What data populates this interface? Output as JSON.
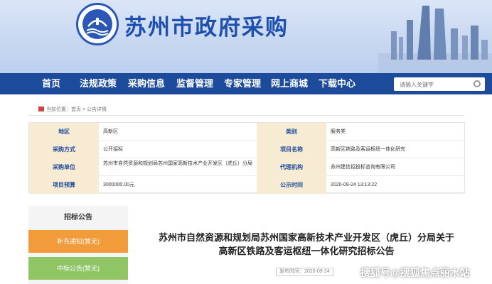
{
  "header": {
    "site_title": "苏州市政府采购"
  },
  "nav": {
    "items": [
      "首页",
      "法规政策",
      "采购信息",
      "监督管理",
      "专家管理",
      "网上商城",
      "下载中心"
    ],
    "search_placeholder": "请输入关键字"
  },
  "breadcrumb": {
    "current_label": "当前位置：",
    "path": "首页 > 公告详情"
  },
  "info": {
    "rows": [
      {
        "label_left": "地区",
        "value_left": "高新区",
        "label_right": "类别",
        "value_right": "服务类"
      },
      {
        "label_left": "采购方式",
        "value_left": "公开招标",
        "label_right": "项目名称",
        "value_right": "高新区铁路及客运枢纽一体化研究"
      },
      {
        "label_left": "采购单位",
        "value_left": "苏州市自然资源和规划局苏州国家高新技术产业开发区（虎丘）分局",
        "label_right": "代理机构",
        "value_right": "苏州建信招投标咨询有限公司"
      },
      {
        "label_left": "项目预算",
        "value_left": "3000000.00元",
        "label_right": "公示时间",
        "value_right": "2020-09-24 13:13:22"
      }
    ]
  },
  "sidebar": {
    "heading": "招标公告",
    "buttons": [
      "补充通知(暂无)",
      "中标公告(暂无)"
    ]
  },
  "article": {
    "title_line1": "苏州市自然资源和规划局苏州国家高新技术产业开发区（虎丘）分局关于",
    "title_line2": "高新区铁路及客运枢纽一体化研究招标公告",
    "publish_time": "发布时间：2020-09-24"
  },
  "watermark": "搜狐号@搜狐焦点丽水站",
  "colors": {
    "nav_bg": "#1d4b9c",
    "title_blue": "#1d4fae",
    "label_bg": "#f7ebd3",
    "orange": "#f19b3b",
    "green": "#8fc565"
  }
}
